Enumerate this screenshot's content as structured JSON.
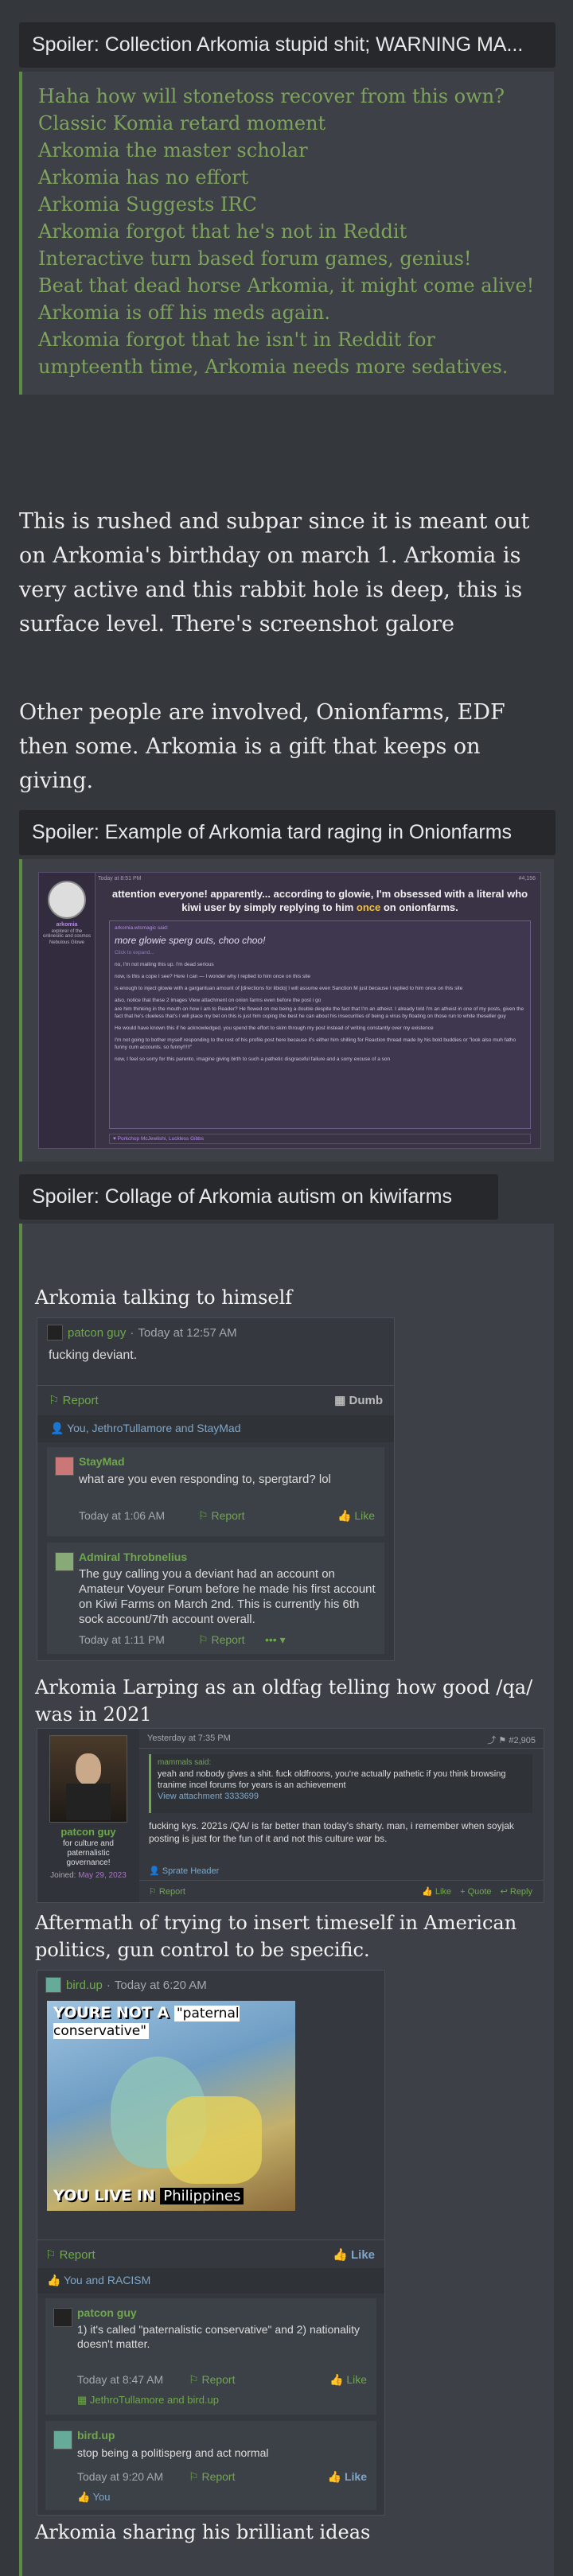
{
  "spoiler1": {
    "title": "Spoiler: Collection Arkomia stupid shit; WARNING MA...",
    "lines": [
      "Haha how will stonetoss recover from this own?",
      "Classic Komia retard moment",
      "Arkomia the master scholar",
      "Arkomia has no effort",
      "Arkomia Suggests IRC",
      "Arkomia forgot that he's not in Reddit",
      "Interactive turn based forum games, genius!",
      "Beat that dead horse Arkomia, it might come alive!",
      "Arkomia is off his meds again.",
      "Arkomia forgot that he isn't in Reddit for umpteenth time, Arkomia needs more sedatives."
    ]
  },
  "para1": "This is rushed and subpar since it is meant out on Arkomia's birthday on march 1. Arkomia is very active and this rabbit hole is deep, this is surface level. There's screenshot galore",
  "para2": "Other people are involved, Onionfarms, EDF then some. Arkomia is a gift that keeps on giving.",
  "spoiler2": {
    "title": "Spoiler: Example of Arkomia tard raging in Onionfarms",
    "post": {
      "date": "Today at 8:51 PM",
      "postno": "#4,156",
      "heading": "attention everyone! apparently... according to glowie, I'm obsessed with a literal who kiwi user by simply replying to him",
      "heading_once": "once",
      "heading_tail": "on onionfarms.",
      "user": "arkomia",
      "user_title": "arkomia",
      "user_desc": "explorer of the onlinesilic and cosmos",
      "user_role": "Nebulous Glowe",
      "quote_head": "arkomia.wtsmagic said:",
      "quote_big": "more glowie sperg outs, choo choo!",
      "quote_link": "Click to expand...",
      "body1": "no, I'm not mailing this up. I'm dead serious",
      "body2": "now, is this a cope I see? Here I can — I wonder why I replied to him once on this site",
      "body3": "is enough to inject glowie with a gargantuan amount of [directions for libido] I will assume even Sanction M just because I replied to him once on this site",
      "body4": "also, notice that these 2 images View attachment on onion farms even before the post i go",
      "body5": "are him thinking in the mouth on how I am to Reader? He flowed on me being a double despite the fact that I'm an atheist. I already told I'm an atheist in one of my posts, given the fact that he's clueless that's I will place my bet on this is just him coping the best he can about his insecurities of being a virus by floating on those run to white theseller guy",
      "body6": "He would have known this if he acknowledged. you spend the effort to skim through my post instead of writing constantly over my existence",
      "body7": "I'm not going to bother myself responding to the rest of his profile post here because it's either him shilling for Reaction thread made by his bold buddies or \"look also muh fatho funny cum accounts. so funny!!!!!\"",
      "body8": "now, I feel so sorry for this parento. imagine giving birth to such a pathetic disgraceful failure and a sorry excuse of a son",
      "reactions": "Porkchop McJewlishi, Luckless Gibbs"
    }
  },
  "spoiler3": {
    "title": "Spoiler: Collage of Arkomia autism on kiwifarms",
    "cap1": "Arkomia talking to himself",
    "cap2": "Arkomia Larping as an oldfag telling how good /qa/ was in 2021",
    "cap3": "Aftermath of trying to insert timeself in American politics, gun control to be specific.",
    "cap4": "Arkomia sharing his brilliant ideas",
    "shot1": {
      "user": "patcon guy",
      "time": "Today at 12:57 AM",
      "text": "fucking deviant.",
      "report": "Report",
      "dumb": "Dumb",
      "reactors": "You, JethroTullamore and StayMad",
      "reply1_user": "StayMad",
      "reply1_text": "what are you even responding to, spergtard? lol",
      "reply1_time": "Today at 1:06 AM",
      "reply1_report": "Report",
      "reply1_like": "Like",
      "reply2_user": "Admiral Throbnelius",
      "reply2_text": "The guy calling you a deviant had an account on Amateur Voyeur Forum before he made his first account on Kiwi Farms on March 2nd. This is currently his 6th sock account/7th account overall.",
      "reply2_time": "Today at 1:11 PM",
      "reply2_report": "Report"
    },
    "shot2": {
      "time": "Yesterday at 7:35 PM",
      "postno": "#2,905",
      "quote_head": "mammals said:",
      "quote_text": "yeah and nobody gives a shit. fuck oldfroons, you're actually pathetic if you think browsing tranime incel forums for years is an achievement",
      "quote_link": "View attachment 3333699",
      "body": "fucking kys. 2021s /QA/ is far better than today's sharty. man, i remember when soyjak posting is just for the fun of it and not this culture war bs.",
      "user": "patcon guy",
      "user_title": "for culture and paternalistic governance!",
      "joined_label": "Joined:",
      "joined": "May 29, 2023",
      "reactor": "Sprate Header",
      "report": "Report",
      "like": "Like",
      "quote": "Quote",
      "reply": "Reply"
    },
    "shot3": {
      "user": "bird.up",
      "time": "Today at 6:20 AM",
      "meme_top_a": "YOURE NOT A",
      "meme_top_b": "\"paternal conservative\"",
      "meme_bottom_a": "YOU LIVE IN",
      "meme_bottom_b": "Philippines",
      "report": "Report",
      "like": "Like",
      "reactors": "You and RACISM",
      "reply1_user": "patcon guy",
      "reply1_text": "1) it's called \"paternalistic conservative\" and 2) nationality doesn't matter.",
      "reply1_time": "Today at 8:47 AM",
      "reply1_report": "Report",
      "reply1_like": "Like",
      "reply1_reactors": "JethroTullamore and bird.up",
      "reply2_user": "bird.up",
      "reply2_text": "stop being a politisperg and act normal",
      "reply2_time": "Today at 9:20 AM",
      "reply2_report": "Report",
      "reply2_like": "Like",
      "reply2_reactors": "You"
    }
  }
}
